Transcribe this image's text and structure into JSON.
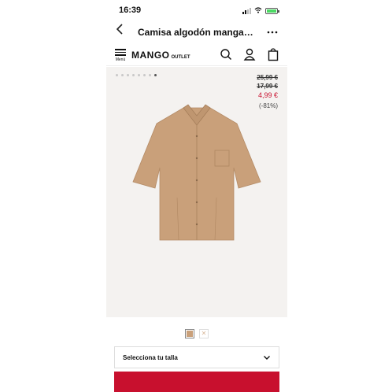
{
  "status_bar": {
    "time": "16:39"
  },
  "nav": {
    "title": "Camisa algodón manga aca..."
  },
  "header": {
    "menu_label": "Menú",
    "logo_main": "MANGO",
    "logo_sub": "OUTLET"
  },
  "gallery": {
    "dot_count": 8,
    "active_dot": 7
  },
  "price": {
    "original": "25,99 €",
    "previous": "17,99 €",
    "sale": "4,99 €",
    "discount": "(-81%)",
    "sale_color": "#c8102e"
  },
  "product": {
    "color": "#c9a07a",
    "swatches": [
      "camel",
      "light-beige"
    ]
  },
  "size_select": {
    "label": "Selecciona tu talla"
  },
  "colors": {
    "accent": "#c8102e",
    "shirt": "#c9a07a"
  },
  "icons": [
    "back-icon",
    "more-icon",
    "menu-icon",
    "search-icon",
    "user-icon",
    "bag-icon",
    "chevron-down-icon"
  ]
}
